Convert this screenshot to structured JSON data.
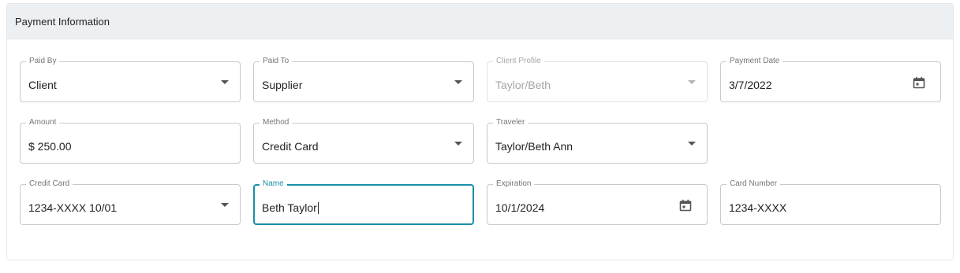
{
  "panel": {
    "title": "Payment Information"
  },
  "fields": {
    "paid_by": {
      "label": "Paid By",
      "value": "Client"
    },
    "paid_to": {
      "label": "Paid To",
      "value": "Supplier"
    },
    "client_profile": {
      "label": "Client Profile",
      "value": "Taylor/Beth"
    },
    "payment_date": {
      "label": "Payment Date",
      "value": "3/7/2022"
    },
    "amount": {
      "label": "Amount",
      "value": "$ 250.00"
    },
    "method": {
      "label": "Method",
      "value": "Credit Card"
    },
    "traveler": {
      "label": "Traveler",
      "value": "Taylor/Beth Ann"
    },
    "credit_card": {
      "label": "Credit Card",
      "value": "1234-XXXX 10/01"
    },
    "name": {
      "label": "Name",
      "value": "Beth Taylor"
    },
    "expiration": {
      "label": "Expiration",
      "value": "10/1/2024"
    },
    "card_number": {
      "label": "Card Number",
      "value": "1234-XXXX"
    }
  },
  "icons": {
    "dropdown": "chevron-down-icon",
    "date": "calendar-icon"
  },
  "colors": {
    "focus": "#1a8fa8",
    "header_bg": "#edf0f3",
    "border": "#c9c9c9"
  }
}
